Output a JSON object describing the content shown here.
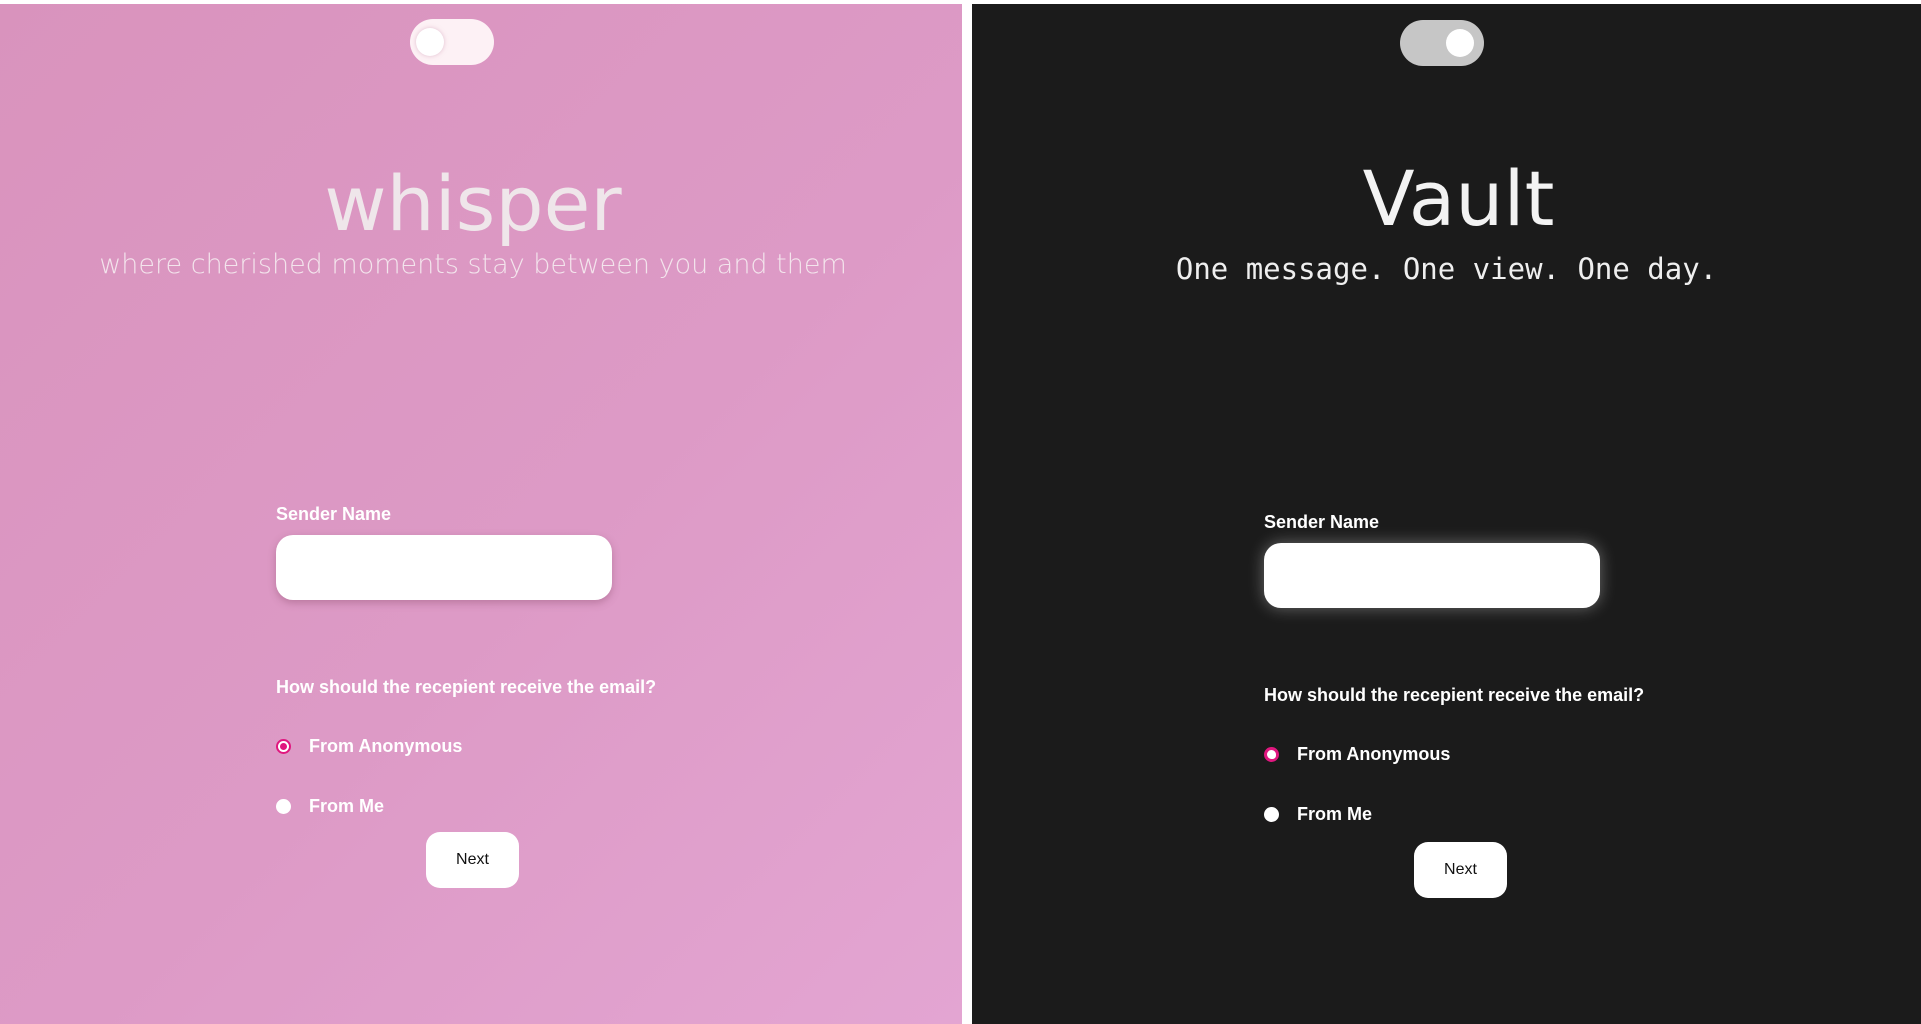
{
  "light": {
    "title": "whisper",
    "subtitle": "where cherished moments stay between you and them",
    "sender_label": "Sender Name",
    "sender_value": "",
    "question": "How should the recepient receive the email?",
    "options": [
      "From Anonymous",
      "From Me"
    ],
    "selected_option": "From Anonymous",
    "next_label": "Next",
    "toggle_state": "off",
    "accent_color": "#e0177f",
    "background_color": "#dd9ac6"
  },
  "dark": {
    "title": "Vault",
    "subtitle": "One message. One view. One day.",
    "sender_label": "Sender Name",
    "sender_value": "",
    "question": "How should the recepient receive the email?",
    "options": [
      "From Anonymous",
      "From Me"
    ],
    "selected_option": "From Anonymous",
    "next_label": "Next",
    "toggle_state": "on",
    "accent_color": "#e0177f",
    "background_color": "#1b1b1b"
  }
}
